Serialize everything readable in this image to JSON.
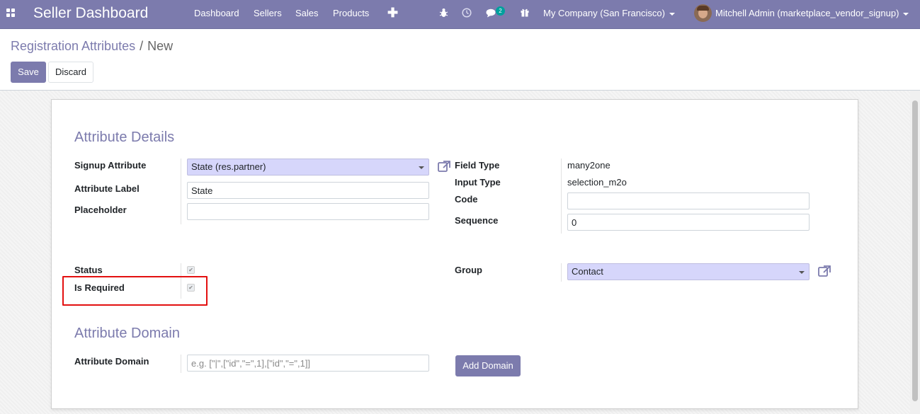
{
  "navbar": {
    "brand": "Seller Dashboard",
    "menu": [
      "Dashboard",
      "Sellers",
      "Sales",
      "Products"
    ],
    "plus_icon": "plus-icon",
    "icons": [
      "bug-icon",
      "clock-icon",
      "chat-icon",
      "gift-icon"
    ],
    "chat_badge": "2",
    "company": "My Company (San Francisco)",
    "user": "Mitchell Admin (marketplace_vendor_signup)",
    "color": "#7c7bad"
  },
  "control_panel": {
    "breadcrumb_parent": "Registration Attributes",
    "breadcrumb_separator": "/",
    "breadcrumb_current": "New",
    "save_label": "Save",
    "discard_label": "Discard"
  },
  "form": {
    "details_title": "Attribute Details",
    "signup_attribute": {
      "label": "Signup Attribute",
      "value": "State (res.partner)"
    },
    "attribute_label": {
      "label": "Attribute Label",
      "value": "State"
    },
    "placeholder": {
      "label": "Placeholder",
      "value": ""
    },
    "field_type": {
      "label": "Field Type",
      "value": "many2one"
    },
    "input_type": {
      "label": "Input Type",
      "value": "selection_m2o"
    },
    "code": {
      "label": "Code",
      "value": ""
    },
    "sequence": {
      "label": "Sequence",
      "value": "0"
    },
    "status": {
      "label": "Status",
      "checked": true
    },
    "is_required": {
      "label": "Is Required",
      "checked": true
    },
    "group": {
      "label": "Group",
      "value": "Contact"
    },
    "domain_title": "Attribute Domain",
    "attribute_domain": {
      "label": "Attribute Domain",
      "placeholder": "e.g. [\"|\",[\"id\",\"=\",1],[\"id\",\"=\",1]]",
      "value": ""
    },
    "add_domain_label": "Add Domain"
  },
  "colors": {
    "accent": "#7c7bad",
    "many2one_bg": "#d6d6fb",
    "highlight": "#e31010"
  }
}
